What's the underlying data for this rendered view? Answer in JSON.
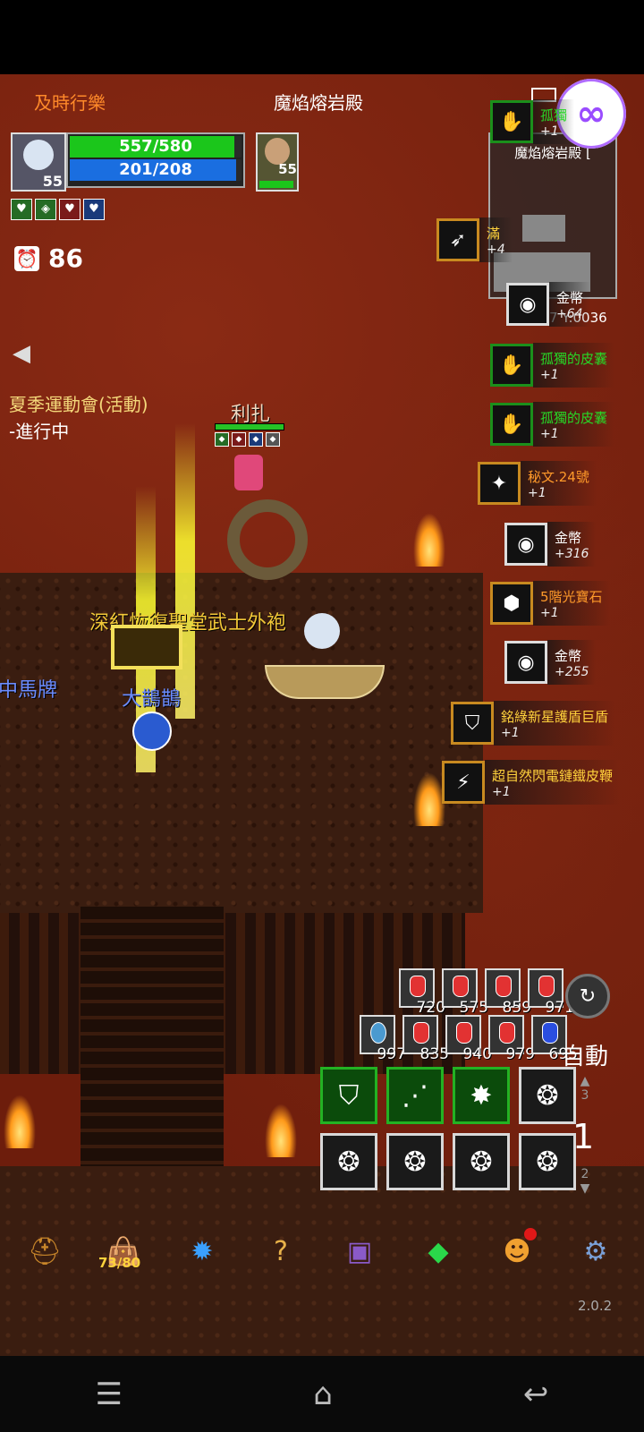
{
  "header": {
    "player_name": "及時行樂",
    "map_name": "魔焰熔岩殿"
  },
  "player": {
    "level": "55",
    "hp": "557/580",
    "hp_fraction": 0.96,
    "mp": "201/208",
    "mp_fraction": 0.97
  },
  "companion": {
    "level": "55",
    "hp_fraction": 1.0
  },
  "timer": {
    "value": "86"
  },
  "minimap": {
    "title": "魔焰熔岩殿 [",
    "coords": "X:0007 Y:0036"
  },
  "event": {
    "title": "夏季運動會(活動)",
    "status": "-進行中"
  },
  "world_labels": {
    "boss_name": "利扎",
    "item_drop": "深紅恢復聖堂武士外袍",
    "npc_name": "大鵲鵲",
    "edge_label": "中馬牌"
  },
  "loot": [
    {
      "name": "孤獨",
      "count": "+1",
      "color": "#27d827",
      "icon": "glove-icon"
    },
    {
      "name": "滿",
      "count": "+4",
      "color": "#ffd23c",
      "icon": "bow-icon"
    },
    {
      "name": "金幣",
      "count": "+64",
      "color": "#ffffff",
      "icon": "gold-icon"
    },
    {
      "name": "孤獨的皮囊",
      "count": "+1",
      "color": "#27d827",
      "icon": "glove-icon"
    },
    {
      "name": "孤獨的皮囊",
      "count": "+1",
      "color": "#27d827",
      "icon": "glove-icon"
    },
    {
      "name": "秘文.24號",
      "count": "+1",
      "color": "#ff9a2a",
      "icon": "rune-icon"
    },
    {
      "name": "金幣",
      "count": "+316",
      "color": "#ffffff",
      "icon": "gold-icon"
    },
    {
      "name": "5階光寶石",
      "count": "+1",
      "color": "#ff9a2a",
      "icon": "gem-icon"
    },
    {
      "name": "金幣",
      "count": "+255",
      "color": "#ffffff",
      "icon": "gold-icon"
    },
    {
      "name": "銘綠新星護盾巨盾",
      "count": "+1",
      "color": "#ffd23c",
      "icon": "shield-icon"
    },
    {
      "name": "超自然閃電鏈鐵皮鞭",
      "count": "+1",
      "color": "#ffd23c",
      "icon": "whip-icon"
    }
  ],
  "potions_row1": [
    "720",
    "575",
    "859",
    "971"
  ],
  "potions_row2": [
    "997",
    "835",
    "940",
    "979",
    "695"
  ],
  "controls": {
    "auto_label": "自動",
    "page_up": "3",
    "page_current": "1",
    "page_down": "2"
  },
  "menu": {
    "bag_count": "73/80"
  },
  "version": "2.0.2"
}
